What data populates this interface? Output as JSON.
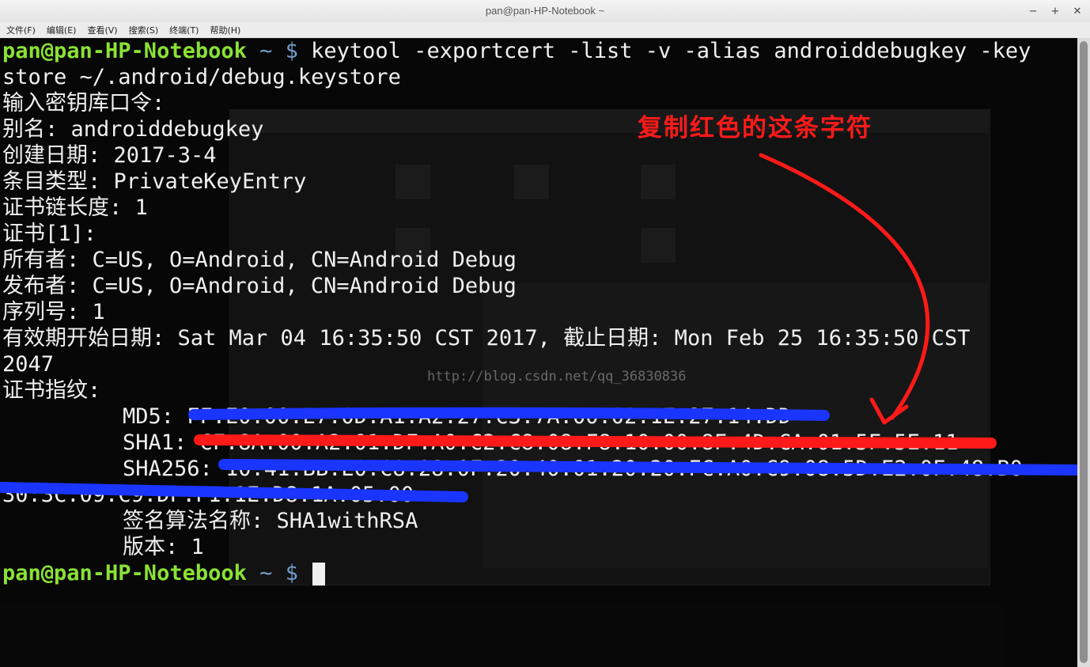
{
  "window": {
    "title": "pan@pan-HP-Notebook ~"
  },
  "controls": {
    "minimize": "−",
    "maximize": "+",
    "close": "✕"
  },
  "menu": [
    "文件(F)",
    "编辑(E)",
    "查看(V)",
    "搜索(S)",
    "终端(T)",
    "帮助(H)"
  ],
  "terminal": {
    "prompt_user": "pan@pan-HP-Notebook",
    "prompt_path": " ~ $ ",
    "command": "keytool -exportcert -list -v -alias androiddebugkey -key",
    "command_cont": "store ~/.android/debug.keystore",
    "output": [
      "输入密钥库口令:",
      "别名: androiddebugkey",
      "创建日期: 2017-3-4",
      "条目类型: PrivateKeyEntry",
      "证书链长度: 1",
      "证书[1]:",
      "所有者: C=US, O=Android, CN=Android Debug",
      "发布者: C=US, O=Android, CN=Android Debug",
      "序列号: 1",
      "有效期开始日期: Sat Mar 04 16:35:50 CST 2017, 截止日期: Mon Feb 25 16:35:50 CST",
      "2047",
      "证书指纹:"
    ],
    "fingerprints": [
      "MD5: FF:E0:00:E7:0D:A1:A2:27:C3:7A:00:02:1E:27:14:DD",
      "SHA1: CF:8A:00:A2:01:DF:A0:C2:C8:08:F8:10:00:8F:4D:CA:01:5F:5E:11",
      "SHA256: 10:41:BB:E0:C8:28:0F:20:40:01:20:20:FC:A0:C9:08:5D:E2:0F:48:B0",
      "30:3C:09:C9:DF:F1:1E:D8:1A:05:00"
    ],
    "sig_lines": [
      "签名算法名称: SHA1withRSA",
      "版本: 1"
    ],
    "watermark": "http://blog.csdn.net/qq_36830836",
    "annotation": "复制红色的这条字符"
  },
  "colors": {
    "annot_red": "#ff1a1a",
    "scribble_blue": "#1a35ff",
    "prompt_green": "#8ae234",
    "prompt_blue": "#729fcf"
  }
}
